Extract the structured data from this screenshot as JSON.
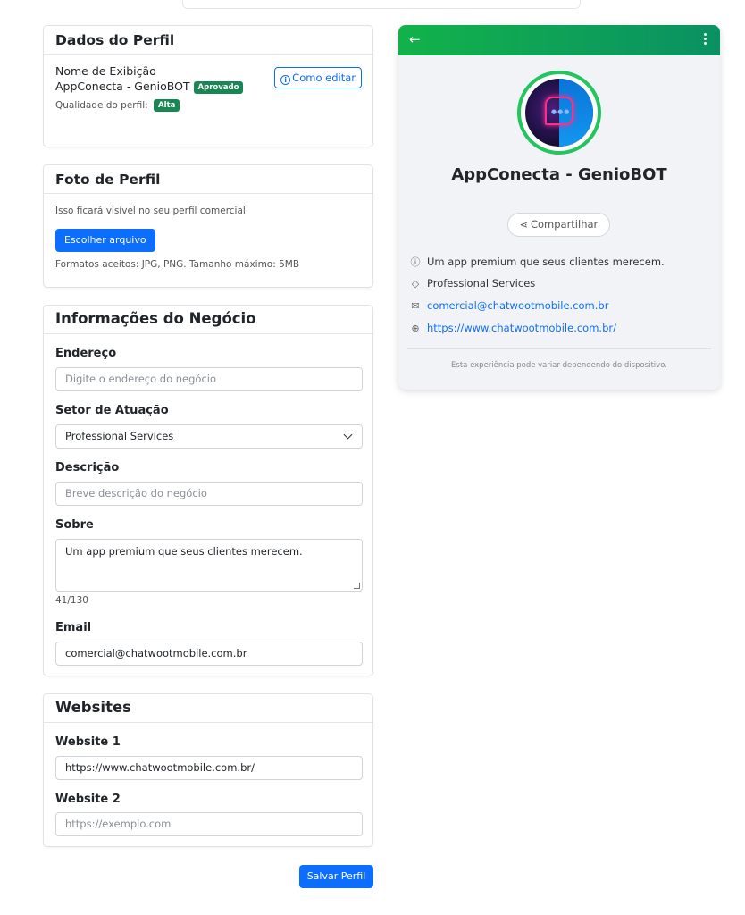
{
  "profile": {
    "title": "Dados do Perfil",
    "display_name_label": "Nome de Exibição",
    "display_name": "AppConecta - GenioBOT",
    "approved_badge": "Aprovado",
    "how_to_edit": "Como editar",
    "quality_label": "Qualidade do perfil:",
    "quality_badge": "Alta"
  },
  "photo": {
    "title": "Foto de Perfil",
    "hint": "Isso ficará visível no seu perfil comercial",
    "choose_file": "Escolher arquivo",
    "formats": "Formatos aceitos: JPG, PNG. Tamanho máximo: 5MB"
  },
  "business": {
    "title": "Informações do Negócio",
    "address_label": "Endereço",
    "address_placeholder": "Digite o endereço do negócio",
    "sector_label": "Setor de Atuação",
    "sector_value": "Professional Services",
    "description_label": "Descrição",
    "description_placeholder": "Breve descrição do negócio",
    "about_label": "Sobre",
    "about_value": "Um app premium que seus clientes merecem.",
    "about_counter": "41/130",
    "email_label": "Email",
    "email_value": "comercial@chatwootmobile.com.br"
  },
  "websites": {
    "title": "Websites",
    "website1_label": "Website 1",
    "website1_value": "https://www.chatwootmobile.com.br/",
    "website2_label": "Website 2",
    "website2_placeholder": "https://exemplo.com"
  },
  "save_button": "Salvar Perfil",
  "preview": {
    "name": "AppConecta - GenioBOT",
    "share": "Compartilhar",
    "about": "Um app premium que seus clientes merecem.",
    "category": "Professional Services",
    "email": "comercial@chatwootmobile.com.br",
    "website": "https://www.chatwootmobile.com.br/",
    "footer": "Esta experiência pode variar dependendo do dispositivo.",
    "header_color": "#12b24a"
  }
}
